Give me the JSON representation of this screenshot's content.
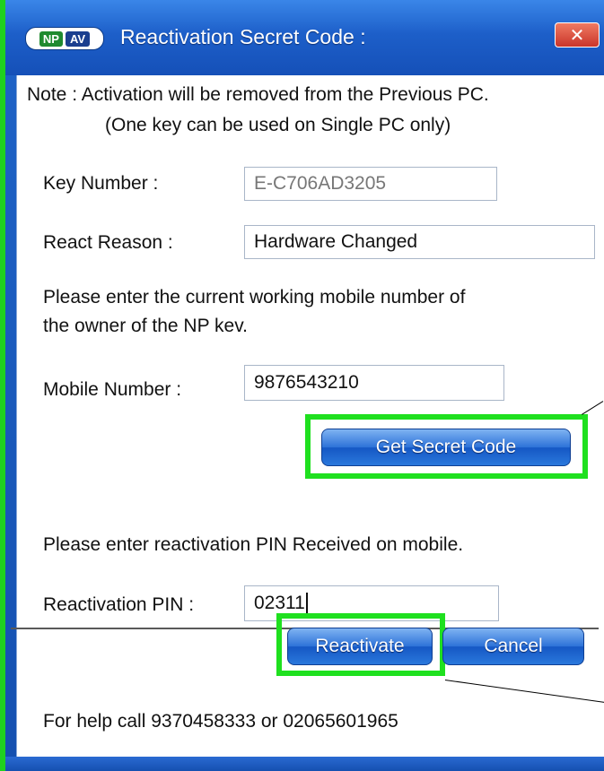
{
  "window": {
    "title": "Reactivation Secret Code :",
    "logo_np": "NP",
    "logo_av": "AV",
    "close_label": "✕"
  },
  "note": {
    "line1": "Note : Activation will be removed from the Previous PC.",
    "line2": "(One key can be used on Single PC only)"
  },
  "key_number": {
    "label": "Key Number :",
    "value": "E-C706AD3205"
  },
  "react_reason": {
    "label": "React Reason :",
    "value": "Hardware Changed"
  },
  "mobile_prompt": {
    "line1": "Please enter the current working mobile number of",
    "line2": "the owner of the NP kev."
  },
  "mobile_number": {
    "label": "Mobile Number :",
    "value": "9876543210"
  },
  "get_secret_code_label": "Get Secret Code",
  "pin_prompt": "Please enter reactivation PIN Received on mobile.",
  "reactivation_pin": {
    "label": "Reactivation PIN :",
    "value": "02311"
  },
  "reactivate_label": "Reactivate",
  "cancel_label": "Cancel",
  "help_text": "For help call 9370458333 or 02065601965",
  "colors": {
    "highlight": "#1fe01f",
    "titlebar": "#1d5fc9",
    "button": "#2d72d8"
  }
}
